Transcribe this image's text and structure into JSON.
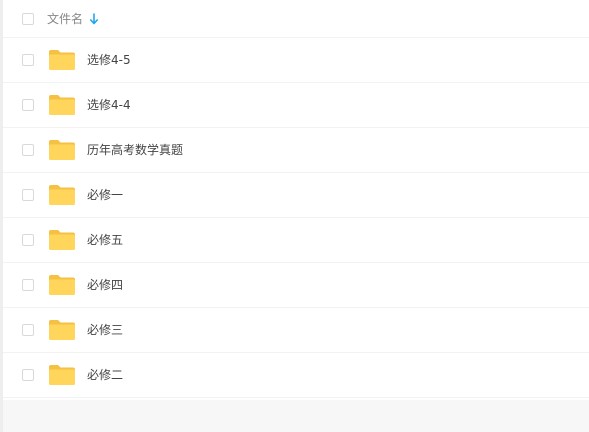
{
  "header": {
    "column_label": "文件名",
    "sort_direction": "descending",
    "sort_icon": "arrow-down-icon",
    "accent_color": "#1ea5f2"
  },
  "folder_color": "#ffd55c",
  "files": [
    {
      "name": "选修4-5",
      "type": "folder",
      "icon": "folder-icon"
    },
    {
      "name": "选修4-4",
      "type": "folder",
      "icon": "folder-icon"
    },
    {
      "name": "历年高考数学真题",
      "type": "folder",
      "icon": "folder-icon"
    },
    {
      "name": "必修一",
      "type": "folder",
      "icon": "folder-icon"
    },
    {
      "name": "必修五",
      "type": "folder",
      "icon": "folder-icon"
    },
    {
      "name": "必修四",
      "type": "folder",
      "icon": "folder-icon"
    },
    {
      "name": "必修三",
      "type": "folder",
      "icon": "folder-icon"
    },
    {
      "name": "必修二",
      "type": "folder",
      "icon": "folder-icon"
    }
  ]
}
